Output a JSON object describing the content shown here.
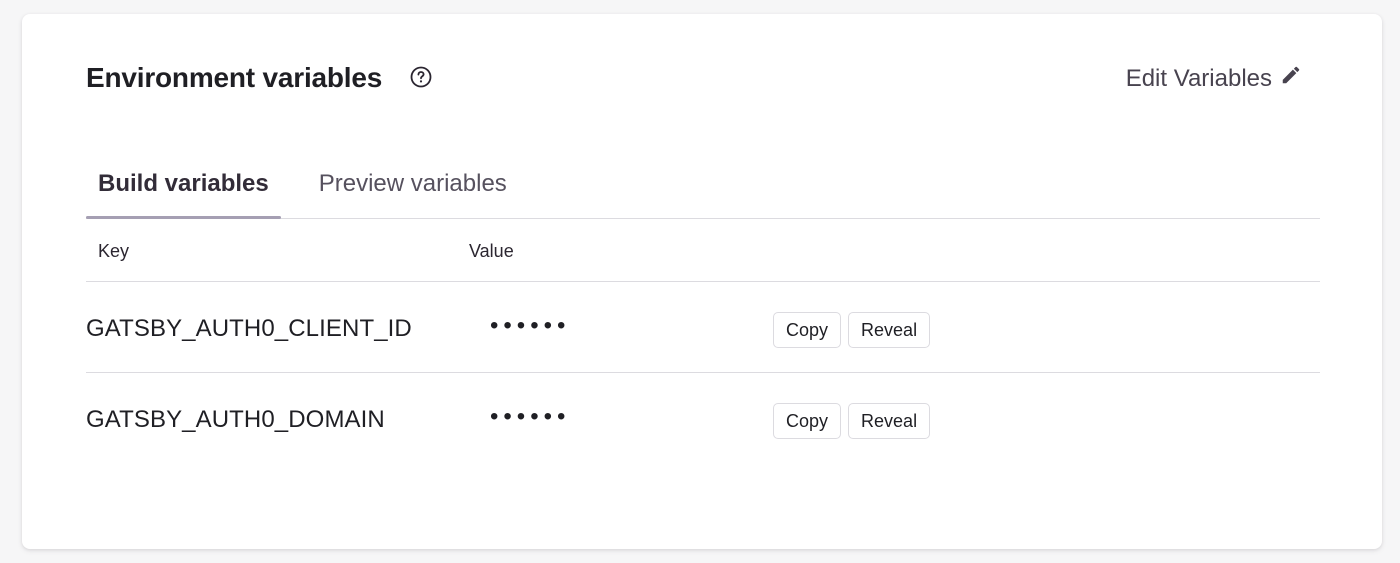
{
  "header": {
    "title": "Environment variables",
    "edit_label": "Edit Variables"
  },
  "tabs": [
    {
      "label": "Build variables",
      "active": true
    },
    {
      "label": "Preview variables",
      "active": false
    }
  ],
  "table": {
    "columns": [
      "Key",
      "Value"
    ],
    "rows": [
      {
        "key": "GATSBY_AUTH0_CLIENT_ID",
        "value": "••••••",
        "copy_label": "Copy",
        "reveal_label": "Reveal"
      },
      {
        "key": "GATSBY_AUTH0_DOMAIN",
        "value": "••••••",
        "copy_label": "Copy",
        "reveal_label": "Reveal"
      }
    ]
  },
  "icons": {
    "help": "question-circle-icon",
    "edit": "pencil-icon"
  },
  "colors": {
    "tab_indicator": "#a59fb3",
    "muted_text": "#48434f"
  }
}
